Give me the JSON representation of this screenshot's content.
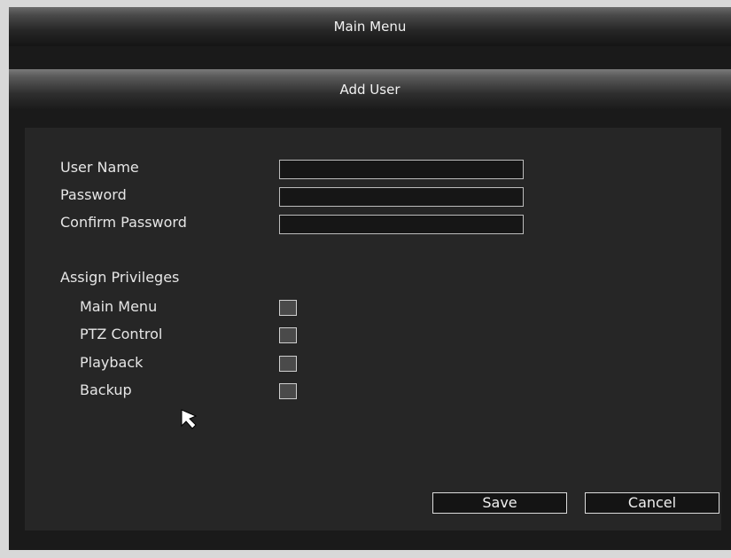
{
  "main_menu": {
    "title": "Main Menu"
  },
  "dialog": {
    "title": "Add User",
    "fields": {
      "user_name": {
        "label": "User Name",
        "value": ""
      },
      "password": {
        "label": "Password",
        "value": ""
      },
      "confirm_password": {
        "label": "Confirm Password",
        "value": ""
      }
    },
    "privileges": {
      "heading": "Assign Privileges",
      "items": [
        {
          "label": "Main Menu",
          "checked": false
        },
        {
          "label": "PTZ Control",
          "checked": false
        },
        {
          "label": "Playback",
          "checked": false
        },
        {
          "label": "Backup",
          "checked": false
        }
      ]
    },
    "buttons": {
      "save": "Save",
      "cancel": "Cancel"
    }
  }
}
